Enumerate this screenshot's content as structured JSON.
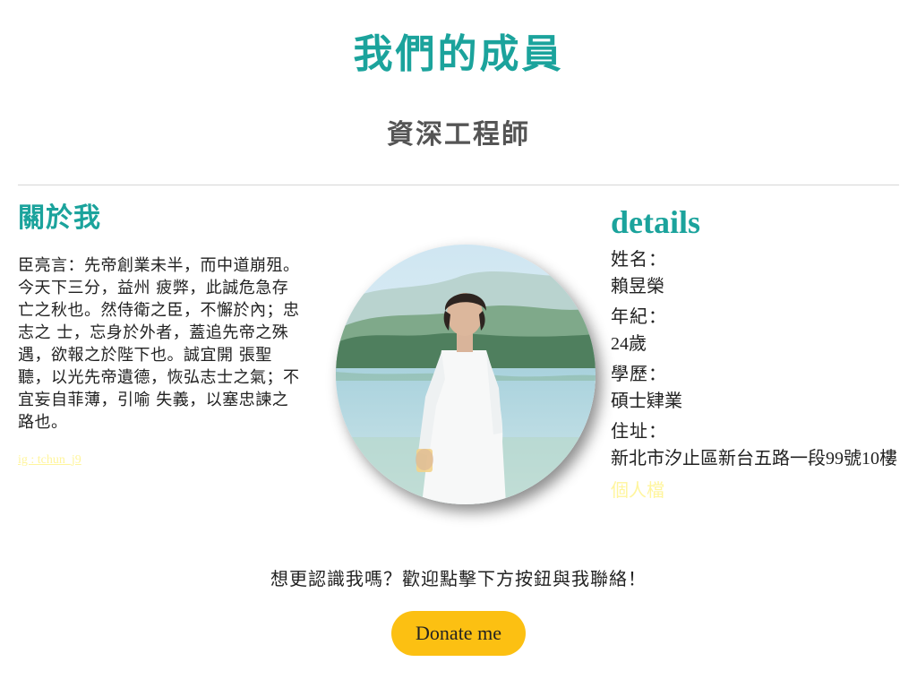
{
  "header": {
    "title": "我們的成員",
    "subtitle": "資深工程師"
  },
  "about": {
    "heading": "關於我",
    "text": "臣亮言：先帝創業未半，而中道崩殂。今天下三分，益州 疲弊，此誠危急存亡之秋也。然侍衛之臣，不懈於內；忠志之 士，忘身於外者，蓋追先帝之殊遇，欲報之於陛下也。誠宜開 張聖聽，以光先帝遺德，恢弘志士之氣；不宜妄自菲薄，引喻 失義，以塞忠諫之路也。",
    "link_label": "ig : tchun_j9"
  },
  "details": {
    "heading": "details",
    "items": [
      {
        "label": "姓名：",
        "value": "賴昱榮"
      },
      {
        "label": "年紀：",
        "value": "24歲"
      },
      {
        "label": "學歷：",
        "value": "碩士肄業"
      },
      {
        "label": "住址：",
        "value": "新北市汐止區新台五路一段99號10樓"
      }
    ],
    "extra": "個人檔"
  },
  "contact": {
    "prompt": "想更認識我嗎？歡迎點擊下方按鈕與我聯絡！",
    "button_label": "Donate me"
  },
  "colors": {
    "accent": "#1ba39c",
    "button": "#fcc012",
    "faint_link": "#fff59d"
  }
}
